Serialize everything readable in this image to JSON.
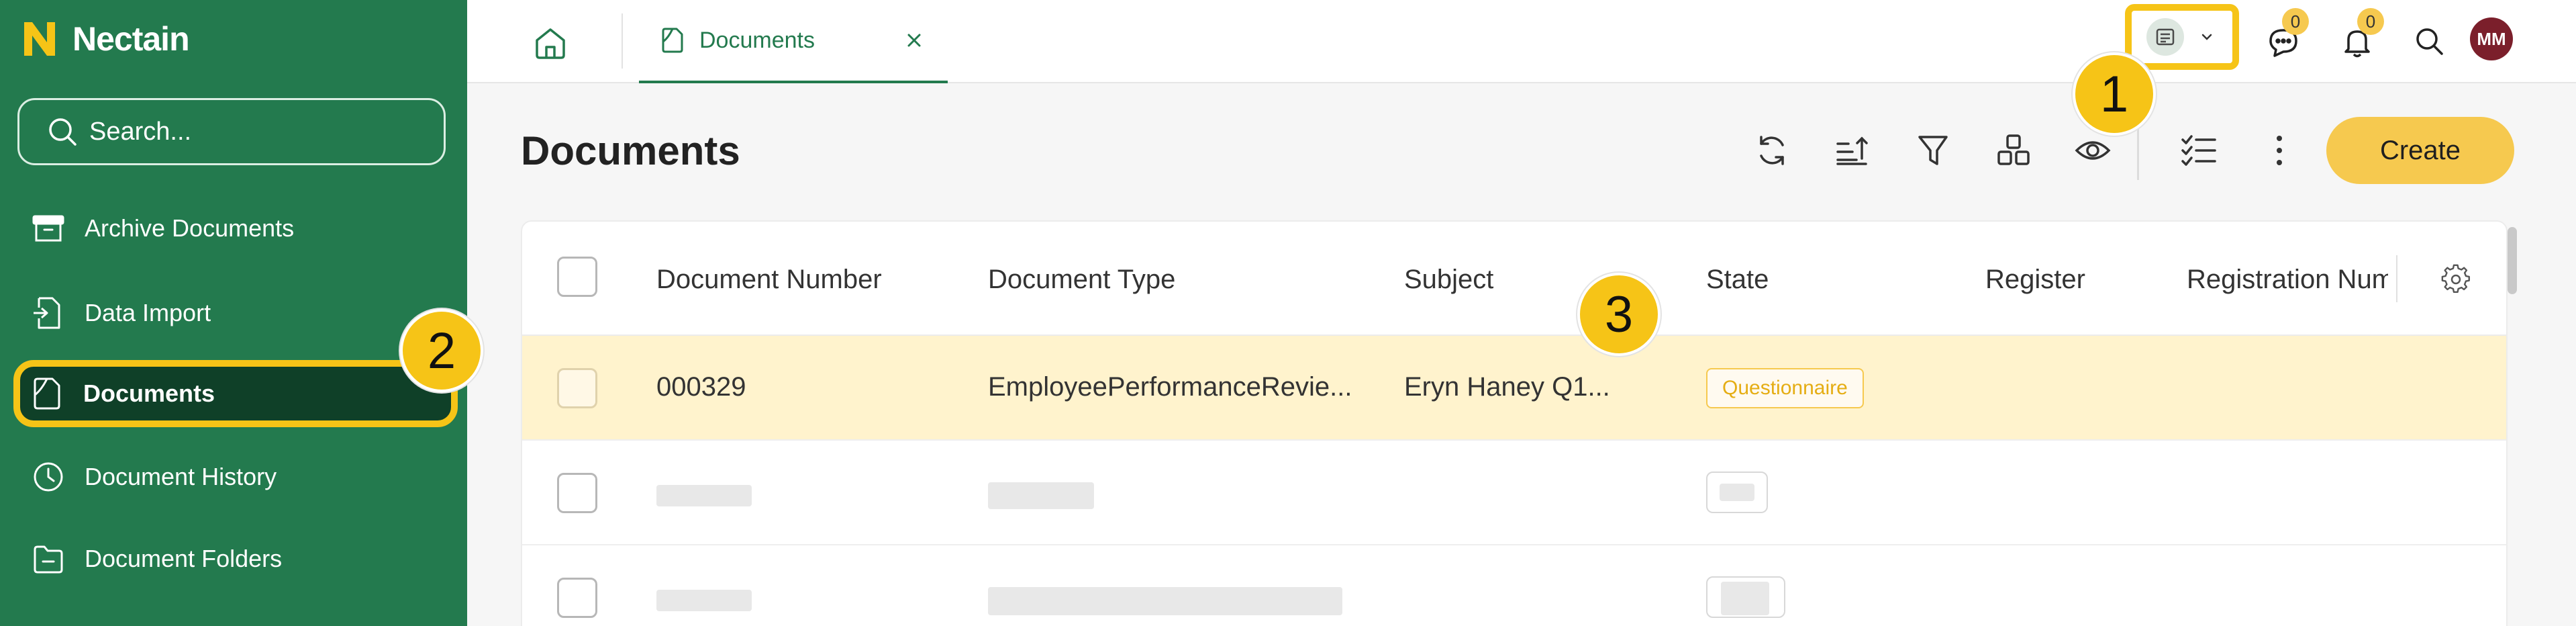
{
  "app": {
    "brand_name": "Nectain"
  },
  "sidebar": {
    "search_placeholder": "Search...",
    "items": [
      {
        "label": "Archive Documents",
        "icon": "archive-icon"
      },
      {
        "label": "Data Import",
        "icon": "import-icon"
      },
      {
        "label": "Documents",
        "icon": "document-icon",
        "active": true
      },
      {
        "label": "Document History",
        "icon": "clock-icon"
      },
      {
        "label": "Document Folders",
        "icon": "folder-icon"
      }
    ]
  },
  "topbar": {
    "home_icon": "home-icon",
    "tab": {
      "label": "Documents",
      "icon": "document-icon",
      "close_icon": "close-icon"
    },
    "workspace_icon": "workspace-icon",
    "messages_count": "0",
    "notifications_count": "0",
    "user_initials": "MM"
  },
  "main": {
    "title": "Documents",
    "toolbar_icons": [
      "refresh-icon",
      "sort-icon",
      "filter-icon",
      "layout-icon",
      "eye-icon",
      "checklist-icon",
      "more-vertical-icon"
    ],
    "create_label": "Create"
  },
  "table": {
    "columns": [
      "Document Number",
      "Document Type",
      "Subject",
      "State",
      "Register",
      "Registration Num"
    ],
    "rows": [
      {
        "document_number": "000329",
        "document_type": "EmployeePerformanceRevie...",
        "subject": "Eryn Haney Q1...",
        "state": "Questionnaire",
        "register": "",
        "registration_number": ""
      }
    ]
  },
  "markers": [
    "1",
    "2",
    "3"
  ],
  "colors": {
    "sidebar_bg": "#237a4e",
    "sidebar_active_bg": "#0f4028",
    "accent_yellow": "#f6c94f",
    "highlight_border": "#f6c417",
    "row_highlight": "#fff3cd",
    "avatar_bg": "#7b1f2b"
  }
}
